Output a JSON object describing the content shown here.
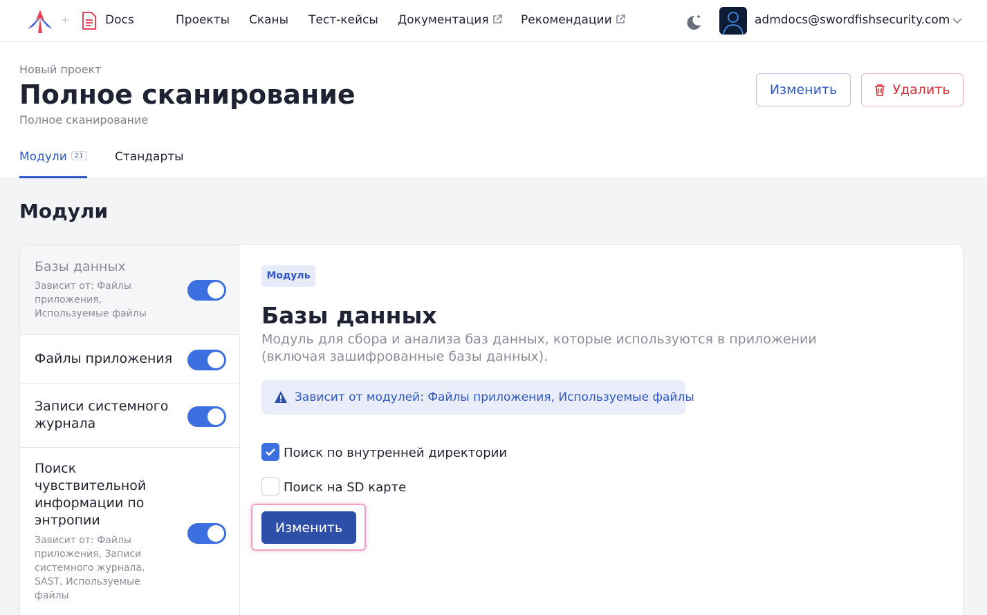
{
  "topbar": {
    "docs_label": "Docs",
    "nav": [
      {
        "label": "Проекты"
      },
      {
        "label": "Сканы"
      },
      {
        "label": "Тест-кейсы"
      },
      {
        "label": "Документация",
        "external": true
      },
      {
        "label": "Рекомендации",
        "external": true
      }
    ],
    "user_email": "admdocs@swordfishsecurity.com"
  },
  "header": {
    "breadcrumb": "Новый проект",
    "title": "Полное сканирование",
    "subtitle": "Полное сканирование",
    "edit_label": "Изменить",
    "delete_label": "Удалить",
    "tabs": [
      {
        "label": "Модули",
        "badge": "21",
        "active": true
      },
      {
        "label": "Стандарты",
        "active": false
      }
    ]
  },
  "section_title": "Модули",
  "modules": [
    {
      "name": "Базы данных",
      "deps": "Зависит от: Файлы приложения, Используемые файлы",
      "enabled": true
    },
    {
      "name": "Файлы приложения",
      "deps": "",
      "enabled": true
    },
    {
      "name": "Записи системного журнала",
      "deps": "",
      "enabled": true
    },
    {
      "name": "Поиск чувствительной информации по энтропии",
      "deps": "Зависит от: Файлы приложения, Записи системного журнала, SAST, Используемые файлы",
      "enabled": true
    }
  ],
  "detail": {
    "badge": "Модуль",
    "title": "Базы данных",
    "description": "Модуль для сбора и анализа баз данных, которые используются в приложении (включая зашифрованные базы данных).",
    "alert": "Зависит от модулей: Файлы приложения, Используемые файлы",
    "options": [
      {
        "label": "Поиск по внутренней директории",
        "checked": true
      },
      {
        "label": "Поиск на SD карте",
        "checked": false
      }
    ],
    "save_label": "Изменить"
  },
  "colors": {
    "accent": "#2f57c8",
    "toggle_on": "#3c6fe0",
    "danger": "#d42d35",
    "primary_button": "#2d4fa8",
    "highlight": "#f3a0c4"
  }
}
